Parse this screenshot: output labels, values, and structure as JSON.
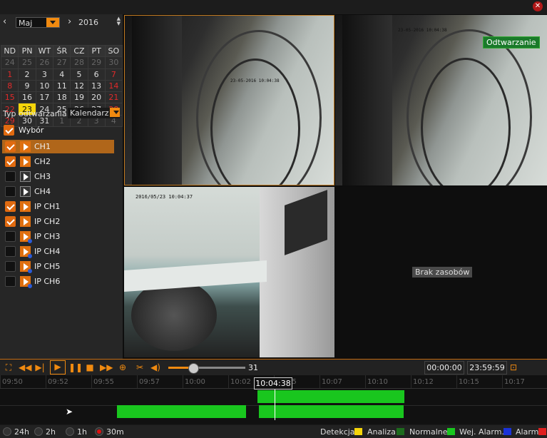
{
  "calendar": {
    "month": "Maj",
    "year": "2016",
    "weekdays": [
      "ND",
      "PN",
      "WT",
      "ŚR",
      "CZ",
      "PT",
      "SO"
    ],
    "days": [
      [
        "24",
        "25",
        "26",
        "27",
        "28",
        "29",
        "30"
      ],
      [
        "1",
        "2",
        "3",
        "4",
        "5",
        "6",
        "7"
      ],
      [
        "8",
        "9",
        "10",
        "11",
        "12",
        "13",
        "14"
      ],
      [
        "15",
        "16",
        "17",
        "18",
        "19",
        "20",
        "21"
      ],
      [
        "22",
        "23",
        "24",
        "25",
        "26",
        "27",
        "28"
      ],
      [
        "29",
        "30",
        "31",
        "1",
        "2",
        "3",
        "4"
      ]
    ],
    "selected_day": "23"
  },
  "playback_type": {
    "label": "Typ odtwarzania",
    "value": "Kalendarz"
  },
  "select_all_label": "Wybór",
  "channels": [
    {
      "label": "CH1",
      "checked": true,
      "icon": "play-orange-icon"
    },
    {
      "label": "CH2",
      "checked": true,
      "icon": "play-orange-icon"
    },
    {
      "label": "CH3",
      "checked": false,
      "icon": "play-grey-icon"
    },
    {
      "label": "CH4",
      "checked": false,
      "icon": "play-grey-icon"
    },
    {
      "label": "IP CH1",
      "checked": true,
      "icon": "play-orange-icon"
    },
    {
      "label": "IP CH2",
      "checked": true,
      "icon": "play-orange-icon"
    },
    {
      "label": "IP CH3",
      "checked": false,
      "icon": "play-ip-icon"
    },
    {
      "label": "IP CH4",
      "checked": false,
      "icon": "play-ip-icon"
    },
    {
      "label": "IP CH5",
      "checked": false,
      "icon": "play-ip-icon"
    },
    {
      "label": "IP CH6",
      "checked": false,
      "icon": "play-ip-icon"
    }
  ],
  "video": {
    "osd1": "23-05-2016 10:04:38",
    "osd2": "23-05-2016 10:04:38",
    "osd3": "2016/05/23 10:04:37",
    "playback_badge": "Odtwarzanie",
    "no_resource": "Brak zasobów"
  },
  "toolbar": {
    "volume_value": "31",
    "start_time": "00:00:00",
    "end_time": "23:59:59"
  },
  "timeline": {
    "ticks": [
      "09:50",
      "09:52",
      "09:55",
      "09:57",
      "10:00",
      "10:02",
      "10:05",
      "10:07",
      "10:10",
      "10:12",
      "10:15",
      "10:17"
    ],
    "cursor_time": "10:04:38",
    "ranges": [
      "24h",
      "2h",
      "1h",
      "30m"
    ],
    "selected_range": "30m"
  },
  "legend": [
    {
      "label": "Detekcja",
      "color": "#f5d50a"
    },
    {
      "label": "Analiza",
      "color": "#1d6b1d"
    },
    {
      "label": "Normalne",
      "color": "#19c61e"
    },
    {
      "label": "Wej. Alarm.",
      "color": "#1a32d8"
    },
    {
      "label": "Alarm",
      "color": "#e02020"
    }
  ]
}
